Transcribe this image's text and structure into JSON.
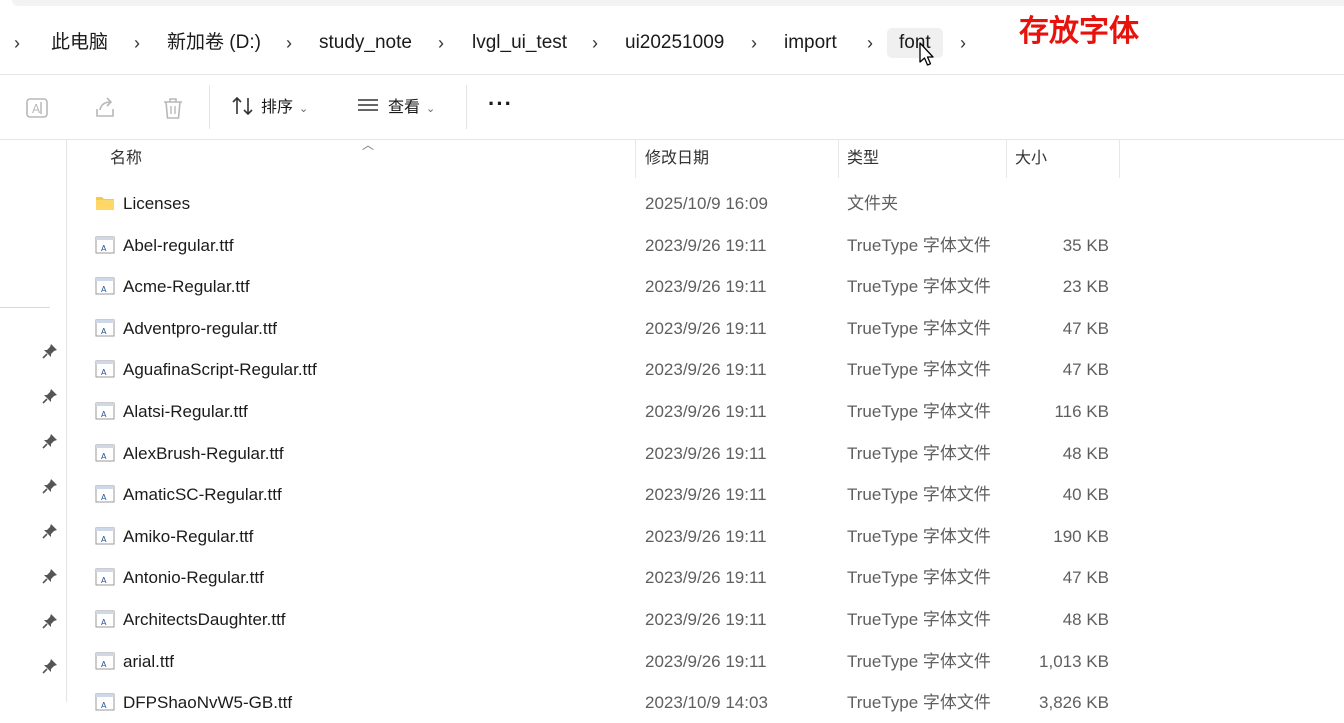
{
  "breadcrumb": {
    "items": [
      "此电脑",
      "新加卷 (D:)",
      "study_note",
      "lvgl_ui_test",
      "ui20251009",
      "import",
      "font"
    ],
    "separator": "›"
  },
  "annotation": {
    "text": "存放字体",
    "color": "#e8120c"
  },
  "toolbar": {
    "sort_label": "排序",
    "view_label": "查看",
    "more_label": "···",
    "icons": [
      "rename-icon",
      "share-icon",
      "delete-icon",
      "sort-icon",
      "view-icon"
    ]
  },
  "columns": {
    "name": "名称",
    "modified": "修改日期",
    "type": "类型",
    "size": "大小"
  },
  "files": [
    {
      "name": "Licenses",
      "date": "2025/10/9 16:09",
      "type": "文件夹",
      "size": "",
      "icon": "folder-icon"
    },
    {
      "name": "Abel-regular.ttf",
      "date": "2023/9/26 19:11",
      "type": "TrueType 字体文件",
      "size": "35 KB",
      "icon": "font-file-icon"
    },
    {
      "name": "Acme-Regular.ttf",
      "date": "2023/9/26 19:11",
      "type": "TrueType 字体文件",
      "size": "23 KB",
      "icon": "font-file-icon"
    },
    {
      "name": "Adventpro-regular.ttf",
      "date": "2023/9/26 19:11",
      "type": "TrueType 字体文件",
      "size": "47 KB",
      "icon": "font-file-icon"
    },
    {
      "name": "AguafinaScript-Regular.ttf",
      "date": "2023/9/26 19:11",
      "type": "TrueType 字体文件",
      "size": "47 KB",
      "icon": "font-file-icon"
    },
    {
      "name": "Alatsi-Regular.ttf",
      "date": "2023/9/26 19:11",
      "type": "TrueType 字体文件",
      "size": "116 KB",
      "icon": "font-file-icon"
    },
    {
      "name": "AlexBrush-Regular.ttf",
      "date": "2023/9/26 19:11",
      "type": "TrueType 字体文件",
      "size": "48 KB",
      "icon": "font-file-icon"
    },
    {
      "name": "AmaticSC-Regular.ttf",
      "date": "2023/9/26 19:11",
      "type": "TrueType 字体文件",
      "size": "40 KB",
      "icon": "font-file-icon"
    },
    {
      "name": "Amiko-Regular.ttf",
      "date": "2023/9/26 19:11",
      "type": "TrueType 字体文件",
      "size": "190 KB",
      "icon": "font-file-icon"
    },
    {
      "name": "Antonio-Regular.ttf",
      "date": "2023/9/26 19:11",
      "type": "TrueType 字体文件",
      "size": "47 KB",
      "icon": "font-file-icon"
    },
    {
      "name": "ArchitectsDaughter.ttf",
      "date": "2023/9/26 19:11",
      "type": "TrueType 字体文件",
      "size": "48 KB",
      "icon": "font-file-icon"
    },
    {
      "name": "arial.ttf",
      "date": "2023/9/26 19:11",
      "type": "TrueType 字体文件",
      "size": "1,013 KB",
      "icon": "font-file-icon"
    },
    {
      "name": "DFPShaoNvW5-GB.ttf",
      "date": "2023/10/9 14:03",
      "type": "TrueType 字体文件",
      "size": "3,826 KB",
      "icon": "font-file-icon"
    }
  ],
  "nav_pins": [
    "pin-icon",
    "pin-icon",
    "pin-icon",
    "pin-icon",
    "pin-icon",
    "pin-icon",
    "pin-icon",
    "pin-icon"
  ]
}
